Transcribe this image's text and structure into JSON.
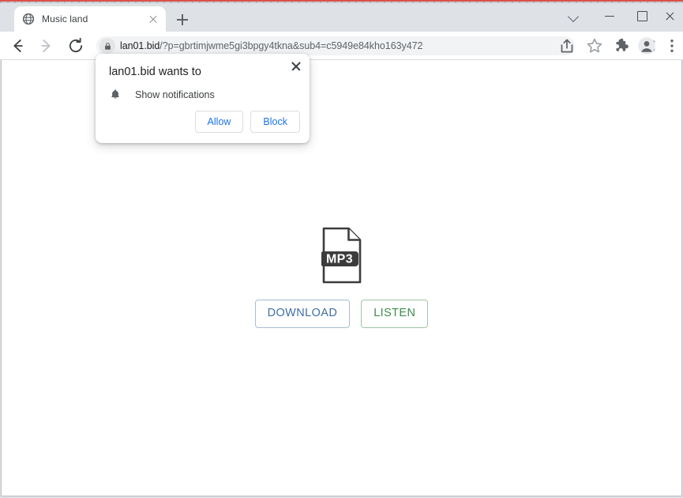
{
  "window": {
    "controls": {
      "tab_search": "tab-search-chevron",
      "minimize": "minimize",
      "maximize": "maximize",
      "close": "close"
    }
  },
  "tab_strip": {
    "tabs": [
      {
        "title": "Music land",
        "favicon": "globe-icon",
        "active": true,
        "close_label": "close-tab"
      }
    ],
    "new_tab_label": "new-tab"
  },
  "toolbar": {
    "back": "back-arrow-icon",
    "forward": "forward-arrow-icon",
    "reload": "reload-icon",
    "home": "home-icon",
    "omnibox": {
      "security_icon": "lock-icon",
      "host": "lan01.bid",
      "path": "/?p=gbrtimjwme5gi3bpgy4tkna&sub4=c5949e84kho163y472",
      "full_url": "lan01.bid/?p=gbrtimjwme5gi3bpgy4tkna&sub4=c5949e84kho163y472"
    },
    "icons": [
      "share-icon",
      "bookmark-star-icon",
      "extensions-puzzle-icon",
      "side-panel-icon",
      "profile-avatar-icon",
      "three-dot-menu-icon"
    ]
  },
  "permission_bubble": {
    "title": "lan01.bid wants to",
    "permission_icon": "bell-icon",
    "permission_label": "Show notifications",
    "allow_label": "Allow",
    "block_label": "Block",
    "close_label": "close-bubble",
    "accent_color": "#1a73e8"
  },
  "page": {
    "file_icon": {
      "name": "mp3-file-icon",
      "badge_text": "MP3",
      "badge_color": "#3c3c3c"
    },
    "buttons": {
      "download_label": "DOWNLOAD",
      "download_color": "#3f6fa6",
      "listen_label": "LISTEN",
      "listen_color": "#3f8a4e"
    }
  }
}
